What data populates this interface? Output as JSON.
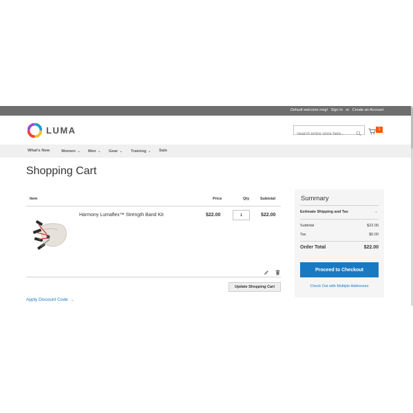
{
  "header_panel": {
    "welcome": "Default welcome msg!",
    "sign_in": "Sign In",
    "or": "or",
    "create_account": "Create an Account"
  },
  "logo": {
    "text": "LUMA",
    "icon": "luma-logo-icon"
  },
  "search": {
    "placeholder": "Search entire store here...",
    "icon": "search-icon"
  },
  "minicart": {
    "count": "1",
    "icon": "cart-icon",
    "badge_color": "#ff5501"
  },
  "nav": {
    "items": [
      {
        "label": "What's New",
        "has_dropdown": false
      },
      {
        "label": "Women",
        "has_dropdown": true
      },
      {
        "label": "Men",
        "has_dropdown": true
      },
      {
        "label": "Gear",
        "has_dropdown": true
      },
      {
        "label": "Training",
        "has_dropdown": true
      },
      {
        "label": "Sale",
        "has_dropdown": false
      }
    ],
    "chevron": "⌄"
  },
  "page_title": "Shopping Cart",
  "cart": {
    "columns": {
      "item": "Item",
      "price": "Price",
      "qty": "Qty",
      "subtotal": "Subtotal"
    },
    "items": [
      {
        "name": "Harmony Lumaflex™ Strength Band Kit",
        "price": "$22.00",
        "qty": "1",
        "subtotal": "$22.00",
        "image": "product-thumbnail"
      }
    ],
    "update_button": "Update Shopping Cart",
    "discount_link": "Apply Discount Code"
  },
  "summary": {
    "title": "Summary",
    "estimate": "Estimate Shipping and Tax",
    "subtotal_label": "Subtotal",
    "subtotal_value": "$22.00",
    "tax_label": "Tax",
    "tax_value": "$0.00",
    "order_total_label": "Order Total",
    "order_total_value": "$22.00",
    "checkout_button": "Proceed to Checkout",
    "multi_address_link": "Check Out with Multiple Addresses"
  },
  "colors": {
    "accent": "#1979c3",
    "topbar": "#6e6e6e",
    "nav_bg": "#f0f0f0",
    "summary_bg": "#f5f5f5"
  }
}
